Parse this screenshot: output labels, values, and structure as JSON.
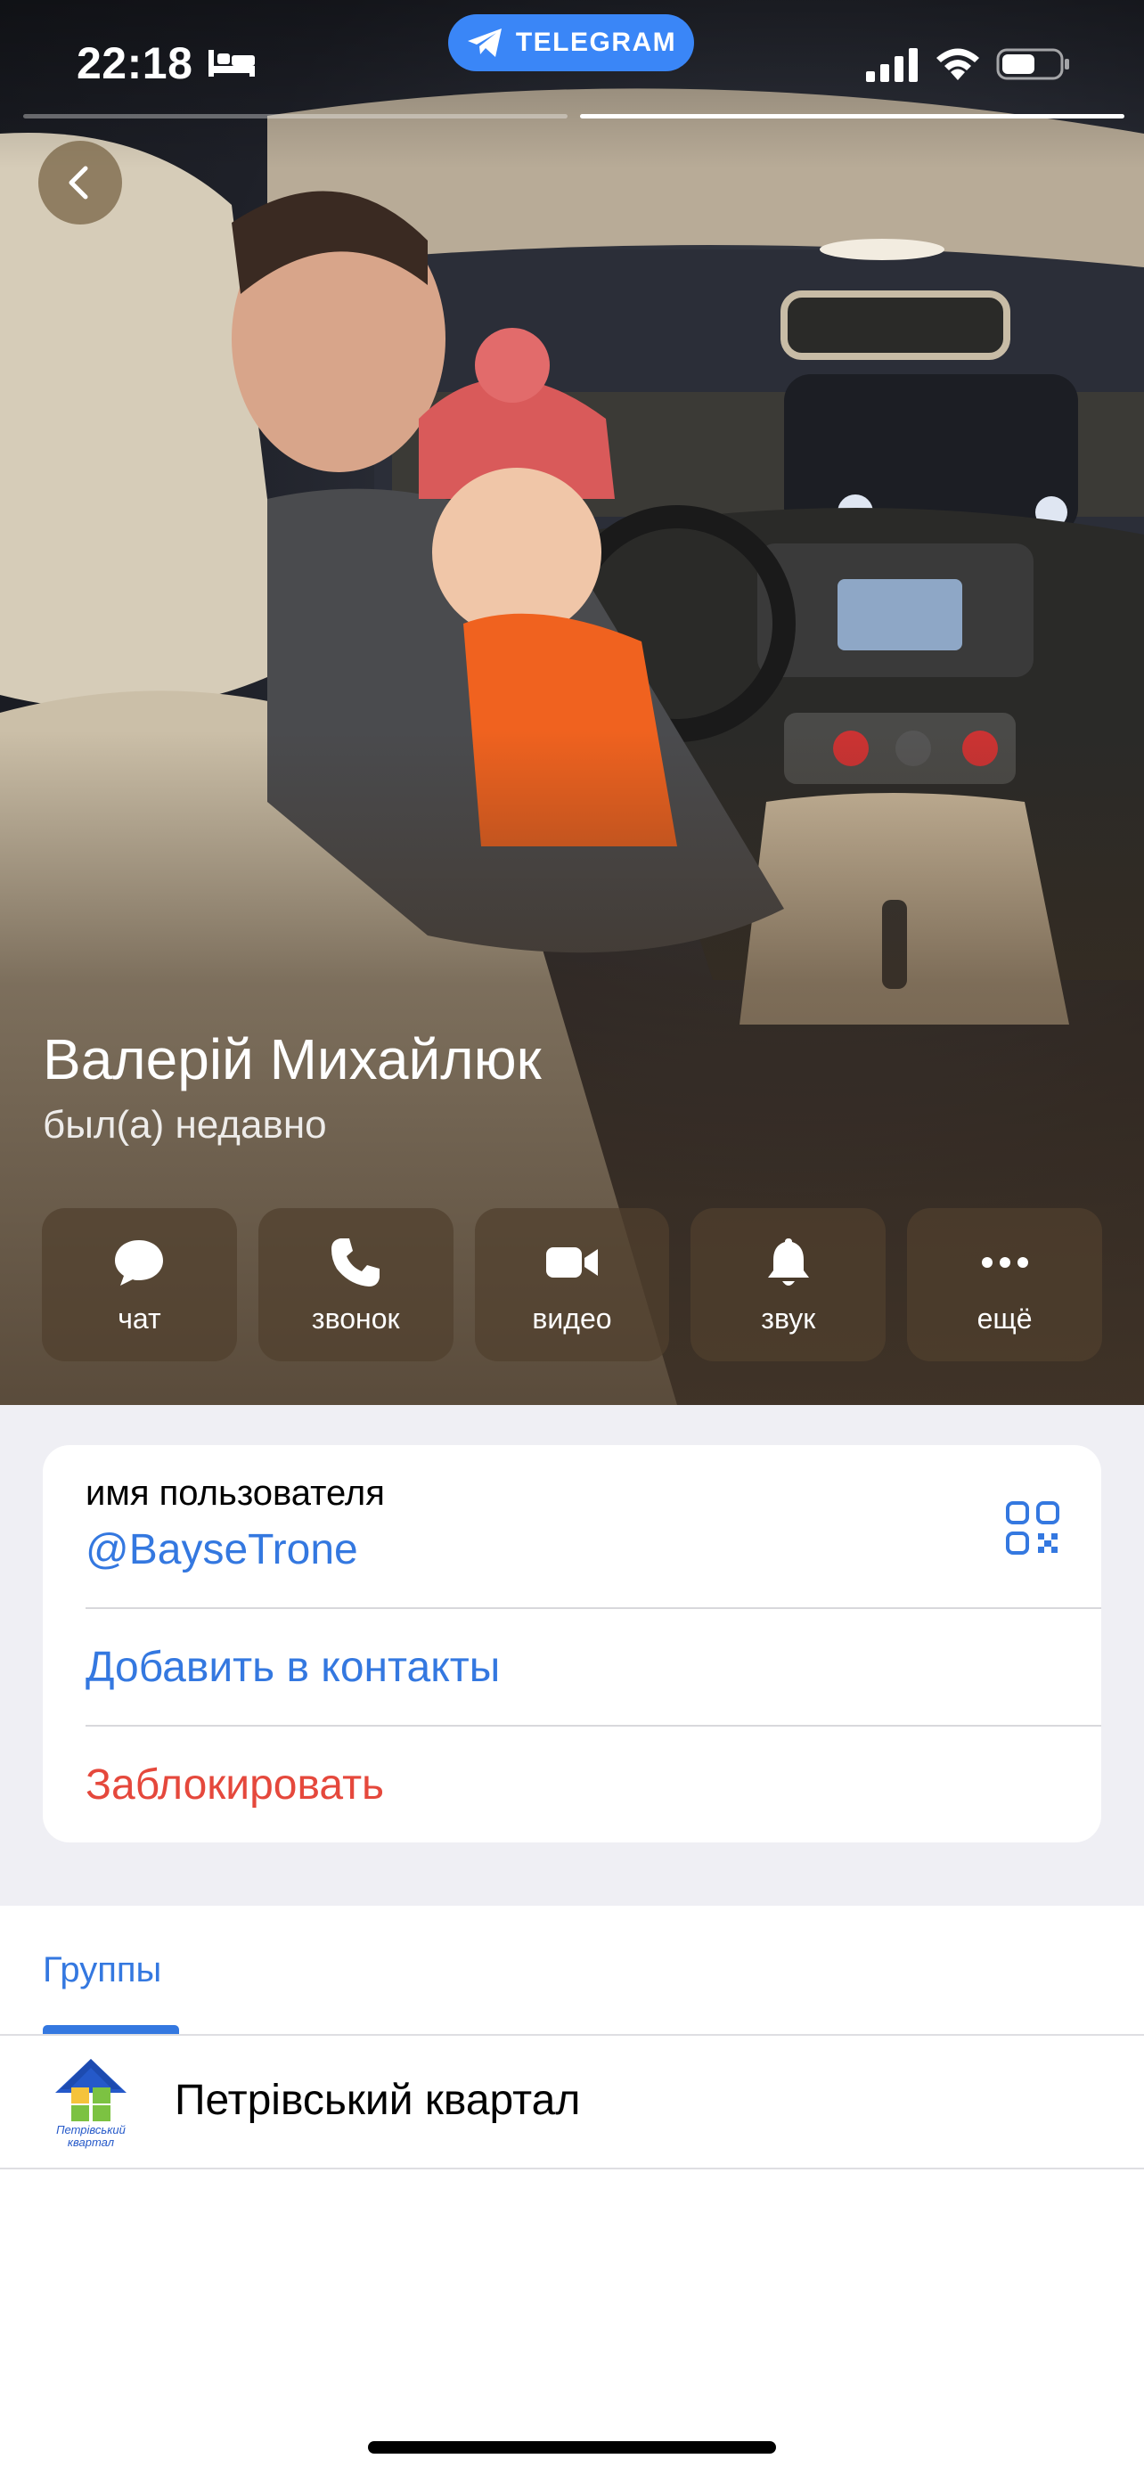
{
  "status_bar": {
    "time": "22:18",
    "app_pill": "TELEGRAM"
  },
  "colors": {
    "accent": "#3478e0",
    "destructive": "#e5483c",
    "telegram_pill": "#3a86f7"
  },
  "profile": {
    "name": "Валерій Михайлюк",
    "last_seen": "был(а) недавно"
  },
  "actions": [
    {
      "label": "чат",
      "icon": "chat-bubble-icon"
    },
    {
      "label": "звонок",
      "icon": "phone-icon"
    },
    {
      "label": "видео",
      "icon": "video-camera-icon"
    },
    {
      "label": "звук",
      "icon": "bell-icon"
    },
    {
      "label": "ещё",
      "icon": "more-dots-icon"
    }
  ],
  "info": {
    "username_label": "имя пользователя",
    "username": "@BayseTrone",
    "add_contact": "Добавить в контакты",
    "block": "Заблокировать"
  },
  "groups": {
    "tab_label": "Группы",
    "items": [
      {
        "name": "Петрівський квартал",
        "logo_text_line1": "Петрівський",
        "logo_text_line2": "квартал"
      }
    ]
  }
}
